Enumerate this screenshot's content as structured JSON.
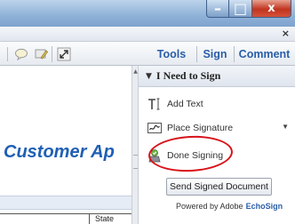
{
  "window": {
    "minimize_glyph": "–",
    "maximize_glyph": "□",
    "close_glyph": "x",
    "menubar_close_glyph": "×"
  },
  "toolbar": {
    "tabs": [
      {
        "label": "Tools"
      },
      {
        "label": "Sign"
      },
      {
        "label": "Comment"
      }
    ],
    "icons": [
      "comment-bubble-icon",
      "highlight-comment-icon",
      "expand-icon"
    ]
  },
  "document": {
    "title_fragment": "Customer Ap",
    "table_header": "State"
  },
  "sign_panel": {
    "header": "I Need to Sign",
    "items": [
      {
        "label": "Add Text",
        "icon": "text-cursor-icon"
      },
      {
        "label": "Place Signature",
        "icon": "signature-icon"
      },
      {
        "label": "Done Signing",
        "icon": "done-signing-icon"
      }
    ],
    "send_button": "Send Signed Document",
    "powered_by": "Powered by Adobe",
    "powered_brand": "EchoSign"
  },
  "colors": {
    "accent_blue": "#2a5ea8",
    "doc_title": "#1f5fb4",
    "annotation_red": "#d8131a",
    "close_button": "#c0341e"
  }
}
